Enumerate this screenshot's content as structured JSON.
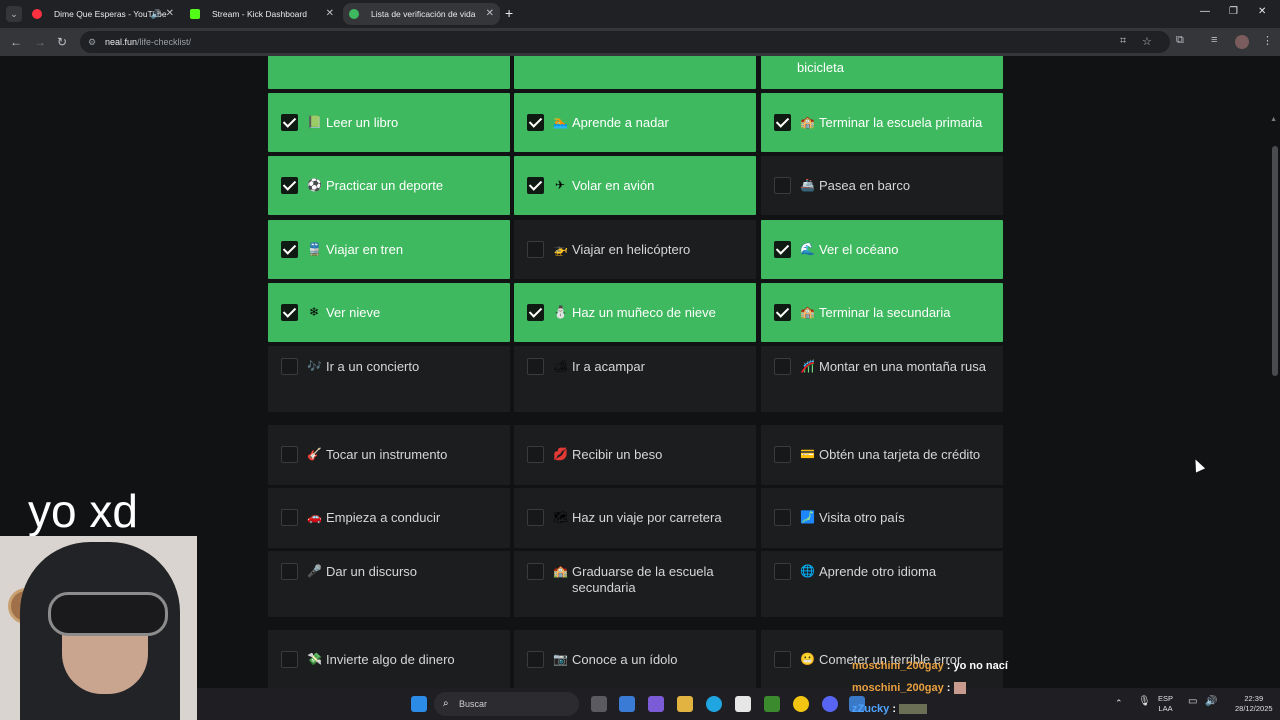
{
  "browser": {
    "tabs": [
      {
        "title": "Dime Que Esperas - YouTube",
        "favicon_color": "#ff3040",
        "audio_icon": "speaker-icon"
      },
      {
        "title": "Stream - Kick Dashboard",
        "favicon_color": "#53fc18"
      },
      {
        "title": "Lista de verificación de vida",
        "favicon_color": "#3eb95f",
        "active": true
      }
    ],
    "address": {
      "domain": "neal.fun",
      "path": "/life-checklist/"
    }
  },
  "checklist": {
    "checked_color": "#3eb95f",
    "top_partial": [
      "",
      "",
      "bicicleta"
    ],
    "rows": [
      [
        {
          "emoji": "📗",
          "label": "Leer un libro",
          "checked": true
        },
        {
          "emoji": "🏊",
          "label": "Aprende a nadar",
          "checked": true
        },
        {
          "emoji": "🏫",
          "label": "Terminar la escuela primaria",
          "checked": true
        }
      ],
      [
        {
          "emoji": "⚽",
          "label": "Practicar un deporte",
          "checked": true
        },
        {
          "emoji": "✈",
          "label": "Volar en avión",
          "checked": true
        },
        {
          "emoji": "🚢",
          "label": "Pasea en barco",
          "checked": false
        }
      ],
      [
        {
          "emoji": "🚆",
          "label": "Viajar en tren",
          "checked": true
        },
        {
          "emoji": "🚁",
          "label": "Viajar en helicóptero",
          "checked": false
        },
        {
          "emoji": "🌊",
          "label": "Ver el océano",
          "checked": true
        }
      ],
      [
        {
          "emoji": "❄",
          "label": "Ver nieve",
          "checked": true
        },
        {
          "emoji": "⛄",
          "label": "Haz un muñeco de nieve",
          "checked": true
        },
        {
          "emoji": "🏫",
          "label": "Terminar la secundaria",
          "checked": true
        }
      ],
      [
        {
          "emoji": "🎶",
          "label": "Ir a un concierto",
          "checked": false
        },
        {
          "emoji": "🏕",
          "label": "Ir a acampar",
          "checked": false
        },
        {
          "emoji": "🎢",
          "label": "Montar en una montaña rusa",
          "checked": false
        }
      ],
      [
        {
          "emoji": "🎸",
          "label": "Tocar un instrumento",
          "checked": false
        },
        {
          "emoji": "💋",
          "label": "Recibir un beso",
          "checked": false
        },
        {
          "emoji": "💳",
          "label": "Obtén una tarjeta de crédito",
          "checked": false
        }
      ],
      [
        {
          "emoji": "🚗",
          "label": "Empieza a conducir",
          "checked": false
        },
        {
          "emoji": "🗺",
          "label": "Haz un viaje por carretera",
          "checked": false
        },
        {
          "emoji": "🗾",
          "label": "Visita otro país",
          "checked": false
        }
      ],
      [
        {
          "emoji": "🎤",
          "label": "Dar un discurso",
          "checked": false
        },
        {
          "emoji": "🏫",
          "label": "Graduarse de la escuela secundaria",
          "checked": false
        },
        {
          "emoji": "🌐",
          "label": "Aprende otro idioma",
          "checked": false
        }
      ],
      [
        {
          "emoji": "💸",
          "label": "Invierte algo de dinero",
          "checked": false
        },
        {
          "emoji": "📷",
          "label": "Conoce a un ídolo",
          "checked": false
        },
        {
          "emoji": "😬",
          "label": "Cometer un terrible error",
          "checked": false
        }
      ]
    ]
  },
  "overlay": {
    "text": "yo xd"
  },
  "chat": [
    {
      "user": "moschini_200gay",
      "message": "yo no nací"
    },
    {
      "user": "moschini_200gay",
      "message": ""
    },
    {
      "user": "zZucky",
      "message": ""
    }
  ],
  "taskbar": {
    "search_placeholder": "Buscar",
    "language": "ESP",
    "layout": "LAA",
    "time": "22:39",
    "date": "28/12/2025"
  }
}
